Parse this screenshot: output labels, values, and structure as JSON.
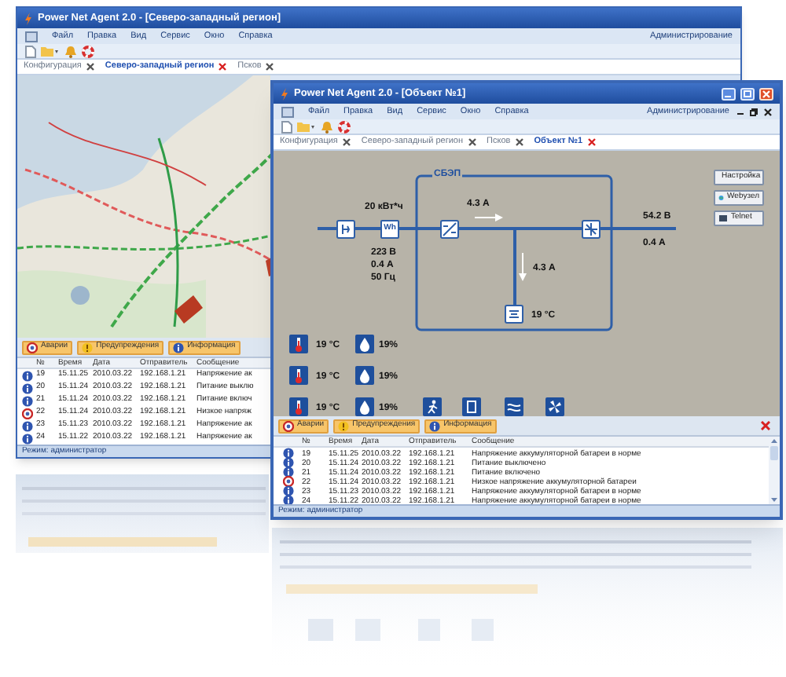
{
  "back_window": {
    "title": "Power Net Agent 2.0 - [Северо-западный регион]",
    "menu": [
      "Файл",
      "Правка",
      "Вид",
      "Сервис",
      "Окно",
      "Справка"
    ],
    "menu_right": "Администрирование",
    "tabs": [
      {
        "label": "Конфигурация",
        "selected": false
      },
      {
        "label": "Северо-западный регион",
        "selected": true
      },
      {
        "label": "Псков",
        "selected": false
      }
    ],
    "map": {
      "kind": "picture"
    },
    "log_tabs": [
      {
        "label": "Аварии",
        "kind": "alarm",
        "on": true
      },
      {
        "label": "Предупреждения",
        "kind": "warning",
        "on": true
      },
      {
        "label": "Информация",
        "kind": "info",
        "on": true
      }
    ],
    "columns": [
      "№",
      "Время",
      "Дата",
      "Отправитель",
      "Сообщение"
    ],
    "rows": [
      {
        "kind": "info",
        "number": "19",
        "time": "15.11.25",
        "date": "2010.03.22",
        "sender": "192.168.1.21",
        "message": "Напряжение ак"
      },
      {
        "kind": "info",
        "number": "20",
        "time": "15.11.24",
        "date": "2010.03.22",
        "sender": "192.168.1.21",
        "message": "Питание выклю"
      },
      {
        "kind": "info",
        "number": "21",
        "time": "15.11.24",
        "date": "2010.03.22",
        "sender": "192.168.1.21",
        "message": "Питание включ"
      },
      {
        "kind": "alarm",
        "number": "22",
        "time": "15.11.24",
        "date": "2010.03.22",
        "sender": "192.168.1.21",
        "message": "Низкое напряж"
      },
      {
        "kind": "info",
        "number": "23",
        "time": "15.11.23",
        "date": "2010.03.22",
        "sender": "192.168.1.21",
        "message": "Напряжение ак"
      },
      {
        "kind": "info",
        "number": "24",
        "time": "15.11.22",
        "date": "2010.03.22",
        "sender": "192.168.1.21",
        "message": "Напряжение ак"
      }
    ],
    "status_bar": "Режим: администратор"
  },
  "front_window": {
    "title": "Power Net Agent 2.0 - [Объект №1]",
    "menu": [
      "Файл",
      "Правка",
      "Вид",
      "Сервис",
      "Окно",
      "Справка"
    ],
    "menu_right": "Администрирование",
    "tabs": [
      {
        "label": "Конфигурация",
        "selected": false
      },
      {
        "label": "Северо-западный регион",
        "selected": false
      },
      {
        "label": "Псков",
        "selected": false
      },
      {
        "label": "Объект №1",
        "selected": true
      }
    ],
    "diagram": {
      "group_label": "СБЭП",
      "meter_label": "Wh",
      "meter_reading": "20 кВт*ч",
      "input_readings": [
        "223 В",
        "0.4 А",
        "50 Гц"
      ],
      "flow_current": "4.3 А",
      "output_voltage": "54.2 В",
      "output_current": "0.4 А",
      "battery_current": "4.3 А",
      "battery_temperature": "19 °C",
      "sensors": [
        {
          "temperature": "19 °C",
          "humidity": "19%"
        },
        {
          "temperature": "19 °C",
          "humidity": "19%"
        },
        {
          "temperature": "19 °C",
          "humidity": "19%"
        }
      ],
      "side_buttons": [
        {
          "label": "Настройка",
          "kind": "settings"
        },
        {
          "label": "Webузел",
          "kind": "web"
        },
        {
          "label": "Telnet",
          "kind": "terminal"
        }
      ]
    },
    "log_tabs": [
      {
        "label": "Аварии",
        "kind": "alarm",
        "on": true
      },
      {
        "label": "Предупреждения",
        "kind": "warning",
        "on": true
      },
      {
        "label": "Информация",
        "kind": "info",
        "on": true
      }
    ],
    "columns": [
      "№",
      "Время",
      "Дата",
      "Отправитель",
      "Сообщение"
    ],
    "rows": [
      {
        "kind": "info",
        "number": "19",
        "time": "15.11.25",
        "date": "2010.03.22",
        "sender": "192.168.1.21",
        "message": "Напряжение аккумуляторной батареи в норме"
      },
      {
        "kind": "info",
        "number": "20",
        "time": "15.11.24",
        "date": "2010.03.22",
        "sender": "192.168.1.21",
        "message": "Питание выключено"
      },
      {
        "kind": "info",
        "number": "21",
        "time": "15.11.24",
        "date": "2010.03.22",
        "sender": "192.168.1.21",
        "message": "Питание включено"
      },
      {
        "kind": "alarm",
        "number": "22",
        "time": "15.11.24",
        "date": "2010.03.22",
        "sender": "192.168.1.21",
        "message": "Низкое напряжение аккумуляторной батареи"
      },
      {
        "kind": "info",
        "number": "23",
        "time": "15.11.23",
        "date": "2010.03.22",
        "sender": "192.168.1.21",
        "message": "Напряжение аккумуляторной батареи в норме"
      },
      {
        "kind": "info",
        "number": "24",
        "time": "15.11.22",
        "date": "2010.03.22",
        "sender": "192.168.1.21",
        "message": "Напряжение аккумуляторной батареи в норме"
      }
    ],
    "status_bar": "Режим: администратор"
  }
}
